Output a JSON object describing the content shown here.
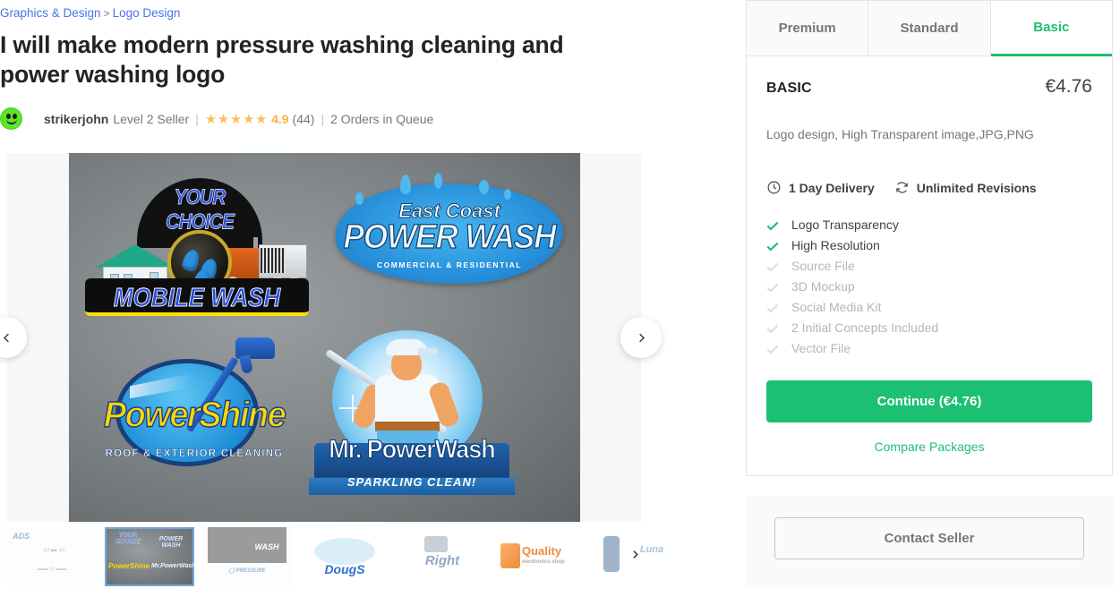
{
  "breadcrumb": {
    "items": [
      {
        "label": "Graphics & Design"
      },
      {
        "label": "Logo Design"
      }
    ],
    "separator": ">"
  },
  "gig": {
    "title": "I will make modern pressure washing cleaning and power washing logo"
  },
  "seller": {
    "avatar_icon": "smiley-face-avatar",
    "username": "strikerjohn",
    "level": "Level 2 Seller",
    "stars": "★★★★★",
    "rating": "4.9",
    "reviews_count": "(44)",
    "orders_in_queue": "2 Orders in Queue",
    "divider": "|"
  },
  "gallery": {
    "prev_icon": "chevron-left-icon",
    "next_icon": "chevron-right-icon",
    "slide": {
      "logos": [
        {
          "id": "your-choice-mobile-wash",
          "arc_text": "YOUR CHOICE",
          "banner_text": "MOBILE WASH"
        },
        {
          "id": "east-coast-power-wash",
          "line1": "East Coast",
          "line2": "POWER WASH",
          "sub": "COMMERCIAL & RESIDENTIAL"
        },
        {
          "id": "powershine",
          "main": "PowerShine",
          "sub": "ROOF & EXTERIOR CLEANING"
        },
        {
          "id": "mr-powerwash",
          "main": "Mr. PowerWash",
          "sub": "SPARKLING CLEAN!"
        }
      ]
    }
  },
  "thumbnails": {
    "next_icon": "chevron-right-icon",
    "items": [
      {
        "id": "thumb-1",
        "label": "ADS",
        "selected": false
      },
      {
        "id": "thumb-2",
        "label": "",
        "selected": true
      },
      {
        "id": "thumb-3",
        "label": "WASH",
        "selected": false
      },
      {
        "id": "thumb-4",
        "label": "DougS",
        "selected": false
      },
      {
        "id": "thumb-5",
        "label": "Right",
        "selected": false
      },
      {
        "id": "thumb-6",
        "label": "Quality",
        "selected": false
      },
      {
        "id": "thumb-7",
        "label": "Luna",
        "selected": false
      }
    ]
  },
  "packages": {
    "tabs": [
      {
        "label": "Premium",
        "active": false
      },
      {
        "label": "Standard",
        "active": false
      },
      {
        "label": "Basic",
        "active": true
      }
    ],
    "selected": {
      "name": "BASIC",
      "price": "€4.76",
      "description": "Logo design, High Transparent image,JPG,PNG",
      "delivery": {
        "icon": "clock-icon",
        "label": "1 Day Delivery"
      },
      "revisions": {
        "icon": "refresh-icon",
        "label": "Unlimited Revisions"
      },
      "features": [
        {
          "label": "Logo Transparency",
          "included": true
        },
        {
          "label": "High Resolution",
          "included": true
        },
        {
          "label": "Source File",
          "included": false
        },
        {
          "label": "3D Mockup",
          "included": false
        },
        {
          "label": "Social Media Kit",
          "included": false
        },
        {
          "label": "2 Initial Concepts Included",
          "included": false
        },
        {
          "label": "Vector File",
          "included": false
        }
      ],
      "continue_label": "Continue (€4.76)",
      "compare_label": "Compare Packages"
    }
  },
  "contact": {
    "button_label": "Contact Seller"
  },
  "colors": {
    "brand_green": "#1dbf73",
    "link_blue": "#4a73e8",
    "star_yellow": "#ffb33e",
    "text_dark": "#404145",
    "text_muted": "#74767e"
  }
}
